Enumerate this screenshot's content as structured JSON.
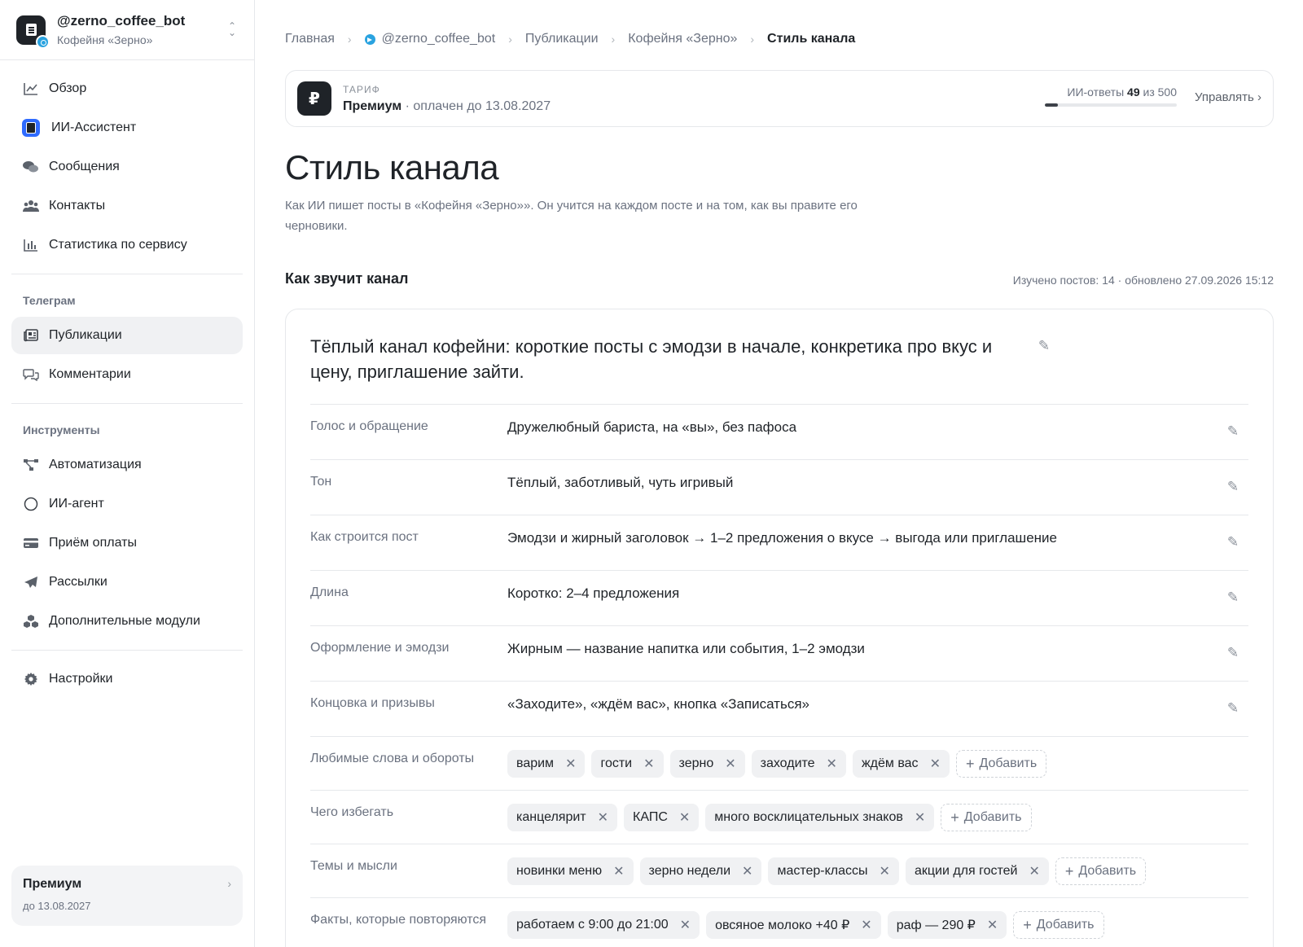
{
  "bot": {
    "name": "@zerno_coffee_bot",
    "subtitle": "Кофейня «Зерно»"
  },
  "sidebar": {
    "main_items": [
      {
        "label": "Обзор",
        "icon": "chart-line-icon"
      },
      {
        "label": "ИИ-Ассистент",
        "icon": "ai-assistant-icon"
      },
      {
        "label": "Сообщения",
        "icon": "chat-bubbles-icon"
      },
      {
        "label": "Контакты",
        "icon": "users-icon"
      },
      {
        "label": "Статистика по сервису",
        "icon": "bar-chart-icon"
      }
    ],
    "telegram_section": "Телеграм",
    "telegram_items": [
      {
        "label": "Публикации",
        "icon": "newspaper-icon",
        "active": true
      },
      {
        "label": "Комментарии",
        "icon": "comments-icon"
      }
    ],
    "tools_section": "Инструменты",
    "tools_items": [
      {
        "label": "Автоматизация",
        "icon": "automation-icon"
      },
      {
        "label": "ИИ-агент",
        "icon": "circle-icon"
      },
      {
        "label": "Приём оплаты",
        "icon": "credit-card-icon"
      },
      {
        "label": "Рассылки",
        "icon": "send-icon"
      },
      {
        "label": "Дополнительные модули",
        "icon": "modules-icon"
      }
    ],
    "settings_label": "Настройки",
    "plan_card": {
      "title": "Премиум",
      "subtitle": "до 13.08.2027"
    }
  },
  "breadcrumb": {
    "home": "Главная",
    "bot": "@zerno_coffee_bot",
    "publications": "Публикации",
    "channel": "Кофейня «Зерно»",
    "current": "Стиль канала"
  },
  "tariff": {
    "label": "ТАРИФ",
    "name": "Премиум",
    "paid_until": " · оплачен до 13.08.2027",
    "usage_prefix": "ИИ-ответы ",
    "usage_used": "49",
    "usage_suffix": " из 500",
    "usage_fraction": 0.098,
    "manage_label": "Управлять"
  },
  "page": {
    "title": "Стиль канала",
    "description": "Как ИИ пишет посты в «Кофейня «Зерно»». Он учится на каждом посте и на том, как вы правите его черновики."
  },
  "section": {
    "title": "Как звучит канал",
    "meta": "Изучено постов: 14 · обновлено 27.09.2026 15:12"
  },
  "summary": "Тёплый канал кофейни: короткие посты с эмодзи в начале, конкретика про вкус и цену, приглашение зайти.",
  "text_rows": [
    {
      "label": "Голос и обращение",
      "value": "Дружелюбный бариста, на «вы», без пафоса"
    },
    {
      "label": "Тон",
      "value": "Тёплый, заботливый, чуть игривый"
    },
    {
      "label": "Как строится пост",
      "value": "Эмодзи и жирный заголовок → 1–2 предложения о вкусе → выгода или приглашение"
    },
    {
      "label": "Длина",
      "value": "Коротко: 2–4 предложения"
    },
    {
      "label": "Оформление и эмодзи",
      "value": "Жирным — название напитка или события, 1–2 эмодзи"
    },
    {
      "label": "Концовка и призывы",
      "value": "«Заходите», «ждём вас», кнопка «Записаться»"
    }
  ],
  "tag_rows": [
    {
      "label": "Любимые слова и обороты",
      "tags": [
        "варим",
        "гости",
        "зерно",
        "заходите",
        "ждём вас"
      ]
    },
    {
      "label": "Чего избегать",
      "tags": [
        "канцелярит",
        "КАПС",
        "много восклицательных знаков"
      ]
    },
    {
      "label": "Темы и мысли",
      "tags": [
        "новинки меню",
        "зерно недели",
        "мастер-классы",
        "акции для гостей"
      ]
    },
    {
      "label": "Факты, которые повторяются",
      "tags": [
        "работаем с 9:00 до 21:00",
        "овсяное молоко +40 ₽",
        "раф — 290 ₽"
      ]
    }
  ],
  "add_label": "Добавить",
  "remove_glyph": "✕"
}
